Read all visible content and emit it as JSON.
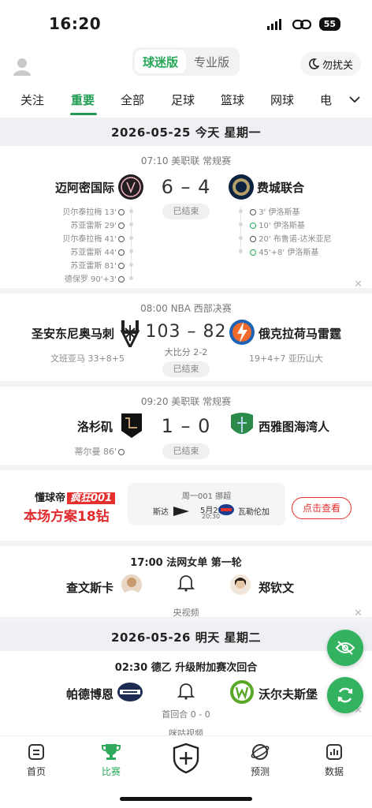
{
  "status": {
    "time": "16:20",
    "battery": "55"
  },
  "header": {
    "modes": [
      "球迷版",
      "专业版"
    ],
    "dnd": "勿扰关"
  },
  "tabs": [
    "关注",
    "重要",
    "全部",
    "足球",
    "篮球",
    "网球",
    "电"
  ],
  "dates": [
    "2026-05-25 今天 星期一",
    "2026-05-26 明天 星期二"
  ],
  "matches": [
    {
      "league": "07:10 美职联 常规赛",
      "home": "迈阿密国际",
      "away": "费城联合",
      "score": "6 – 4",
      "status": "已结束",
      "home_events": [
        "贝尔泰拉梅 13'",
        "苏亚雷斯 29'",
        "贝尔泰拉梅 41'",
        "苏亚雷斯 44'",
        "苏亚雷斯 81'",
        "德保罗 90'+3'"
      ],
      "away_events": [
        "3' 伊洛斯基",
        "10' 伊洛斯基",
        "20' 布鲁诺-达米亚尼",
        "45'+8' 伊洛斯基"
      ]
    },
    {
      "league": "08:00 NBA 西部决赛",
      "home": "圣安东尼奥马刺",
      "away": "俄克拉荷马雷霆",
      "score": "103 – 82",
      "series": "大比分 2-2",
      "status": "已结束",
      "home_stat": "文班亚马 33+8+5",
      "away_stat": "19+4+7 亚历山大"
    },
    {
      "league": "09:20 美职联 常规赛",
      "home": "洛杉矶",
      "away": "西雅图海湾人",
      "score": "1 – 0",
      "status": "已结束",
      "home_events": [
        "蒂尔曼 86'"
      ]
    },
    {
      "league": "17:00 法网女单 第一轮",
      "home": "查文斯卡",
      "away": "郑钦文",
      "broadcast": "央视频"
    },
    {
      "league": "02:30 德乙 升级附加赛次回合",
      "home": "帕德博恩",
      "away": "沃尔夫斯堡",
      "sub": "首回合 0 - 0",
      "broadcast": "咪咕视频"
    }
  ],
  "ad": {
    "brand": "懂球帝",
    "tag": "疯狂001",
    "title": "本场方案18钻",
    "match_label": "周一001 挪超",
    "home": "斯达",
    "away": "瓦勒伦加",
    "date": "5月25日",
    "time": "20:30",
    "start": "START",
    "button": "点击查看"
  },
  "bottom_nav": [
    "首页",
    "比赛",
    "预测",
    "数据"
  ],
  "colors": {
    "accent": "#27a85a",
    "ad_red": "#e53030"
  }
}
